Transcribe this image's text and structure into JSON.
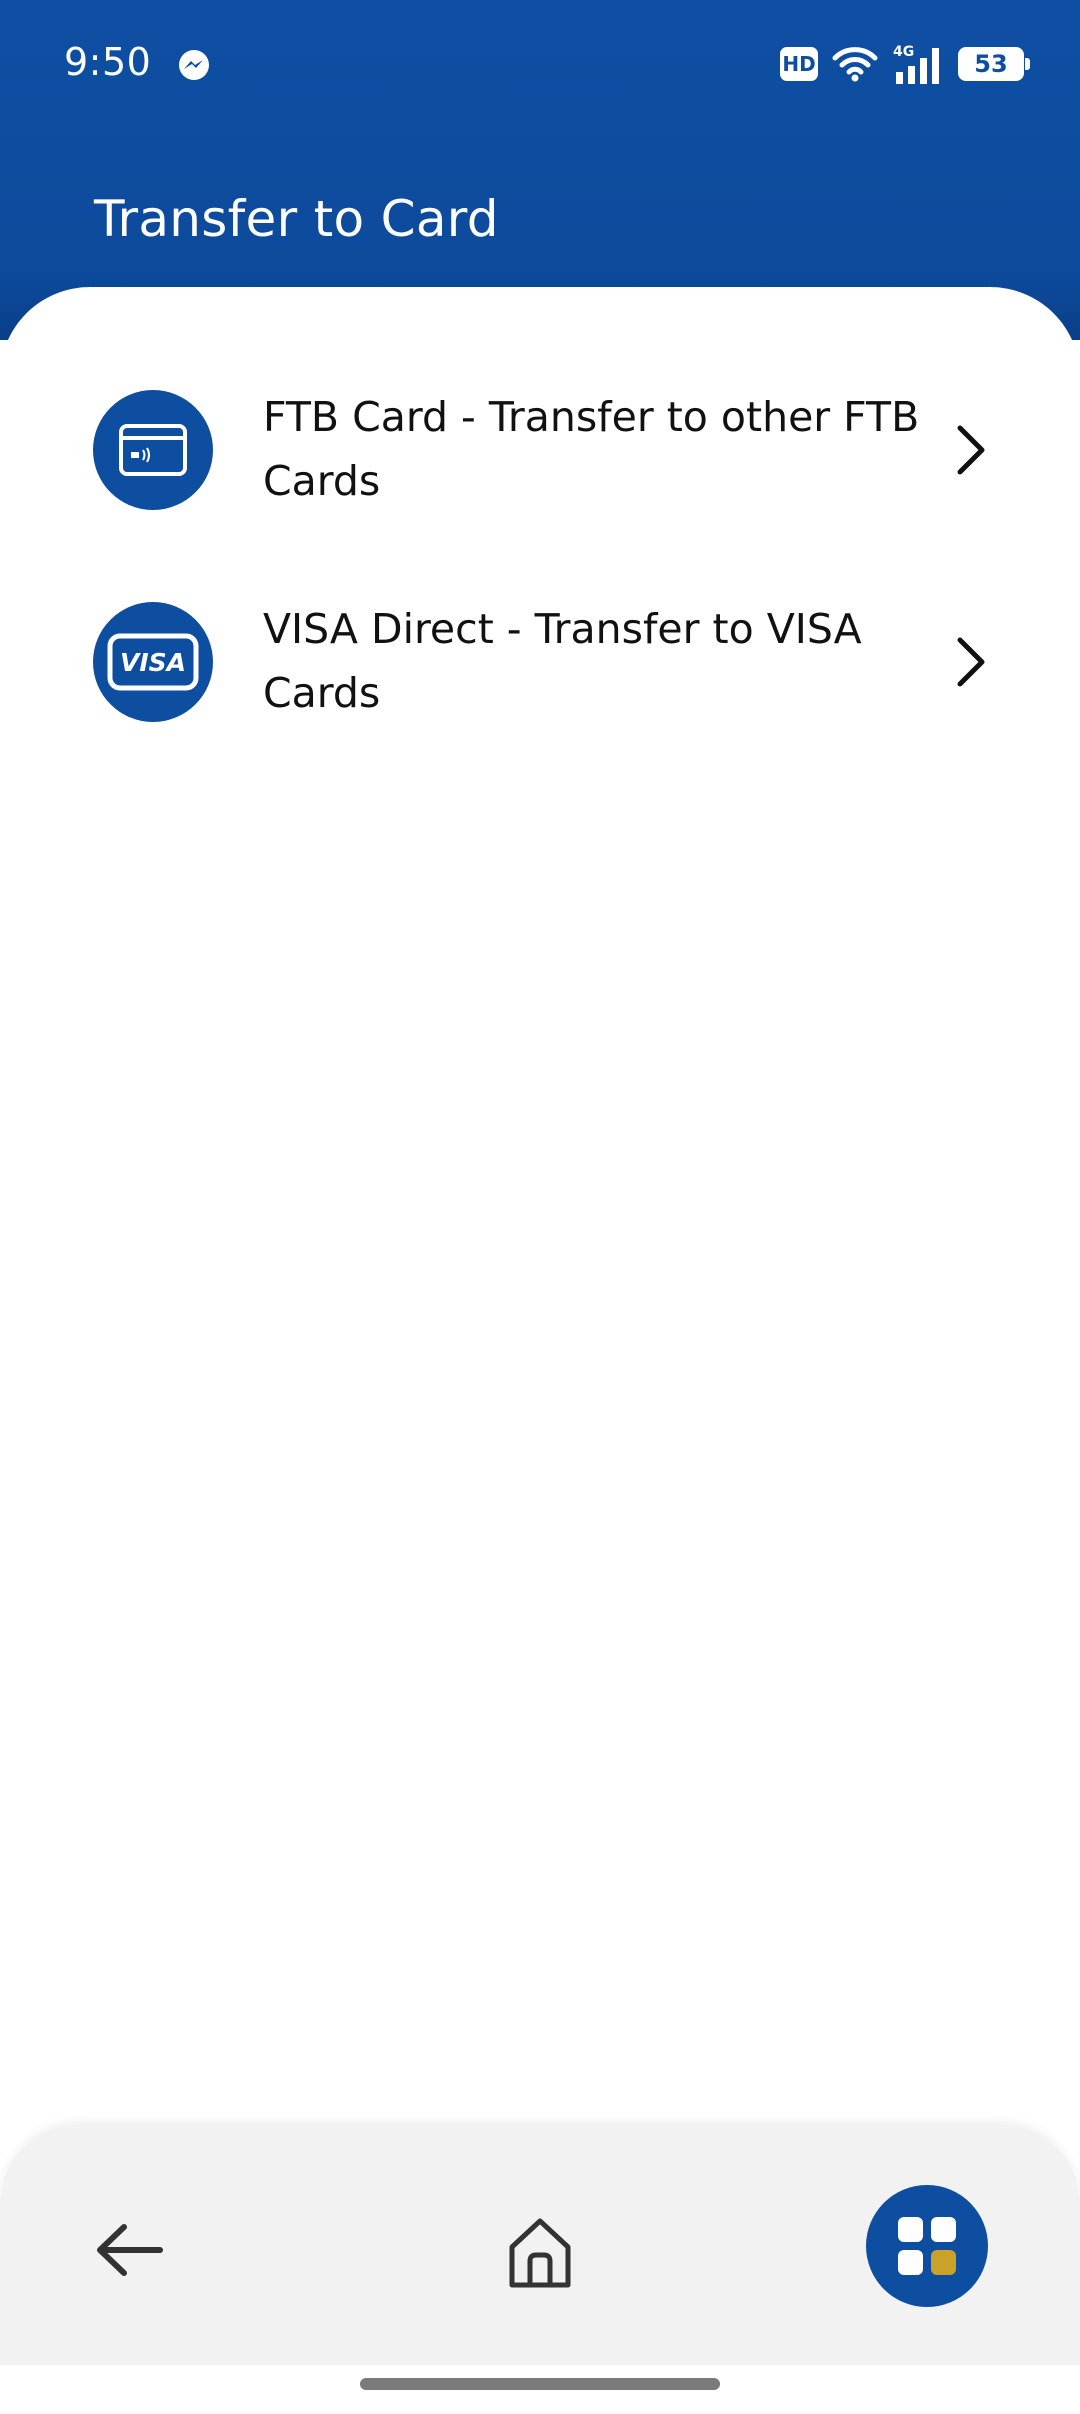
{
  "status_bar": {
    "time": "9:50",
    "hd_label": "HD",
    "network_label": "4G",
    "battery_level": "53",
    "icons": [
      "messenger-icon",
      "wifi-icon",
      "cell-signal-icon",
      "battery-icon"
    ]
  },
  "header": {
    "title": "Transfer to Card"
  },
  "menu": {
    "items": [
      {
        "label": "FTB Card - Transfer to other FTB Cards",
        "icon": "card-icon"
      },
      {
        "label": "VISA Direct - Transfer to VISA Cards",
        "icon": "visa-icon",
        "icon_text": "VISA"
      }
    ]
  },
  "bottom_nav": {
    "items": [
      "back-arrow-icon",
      "home-icon",
      "apps-grid-icon"
    ]
  },
  "colors": {
    "primary": "#0e4ea1",
    "accent": "#c9a227",
    "nav_background": "#f2f2f2"
  }
}
